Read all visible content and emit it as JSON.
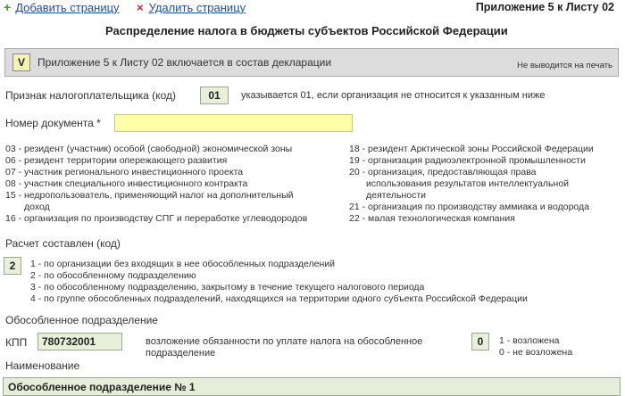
{
  "toolbar": {
    "add_label": "Добавить страницу",
    "delete_label": "Удалить страницу",
    "add_icon": "plus-icon",
    "delete_icon": "x-icon"
  },
  "header": {
    "appendix_title": "Приложение 5 к Листу 02",
    "main_title": "Распределение налога в бюджеты субъектов Российской Федерации"
  },
  "include_bar": {
    "checkbox_value": "V",
    "label": "Приложение 5 к Листу 02 включается в состав декларации",
    "note": "Не выводится на печать"
  },
  "taxpayer_sign": {
    "label": "Признак налогоплательщика (код)",
    "value": "01",
    "hint": "указывается 01, если организация не относится к указанным ниже"
  },
  "document_number": {
    "label": "Номер документа *",
    "value": ""
  },
  "codes_left": [
    "03 - резидент (участник) особой (свободной) экономической зоны",
    "06 - резидент территории опережающего развития",
    "07 - участник регионального инвестиционного проекта",
    "08 - участник специального инвестиционного контракта",
    "15 - недропользователь, применяющий налог на дополнительный",
    "доход",
    "16 - организация по производству СПГ и переработке углеводородов"
  ],
  "codes_right": [
    "18 - резидент Арктической зоны Российской Федерации",
    "19 - организация радиоэлектронной промышленности",
    "20 - организация, предоставляющая права",
    "использования результатов интеллектуальной",
    "деятельности",
    "21 - организация по производству аммиака и водорода",
    "22 - малая технологическая компания"
  ],
  "calculation": {
    "label": "Расчет составлен (код)",
    "value": "2",
    "options": [
      "1 - по организации без входящих в нее обособленных подразделений",
      "2 - по обособленному подразделению",
      "3 - по обособленному подразделению, закрытому в течение текущего налогового периода",
      "4 - по группе обособленных подразделений, находящихся на территории одного субъекта Российской Федерации"
    ]
  },
  "separate_division": {
    "section_label": "Обособленное подразделение",
    "kpp_label": "КПП",
    "kpp_value": "780732001",
    "obligation_line1": "возложение обязанности по уплате налога на обособленное",
    "obligation_line2": "подразделение",
    "obligation_value": "0",
    "option1": "1 - возложена",
    "option2": "0 - не возложена",
    "name_label": "Наименование",
    "name_value": "Обособленное подразделение № 1"
  },
  "colors": {
    "link": "#1f4fa6",
    "plus_icon": "#3a9a2e",
    "delete_icon": "#d11d1d",
    "field_green": "#e8f0dc",
    "field_yellow": "#ffffa8",
    "bar_gray": "#dcdcdc"
  }
}
